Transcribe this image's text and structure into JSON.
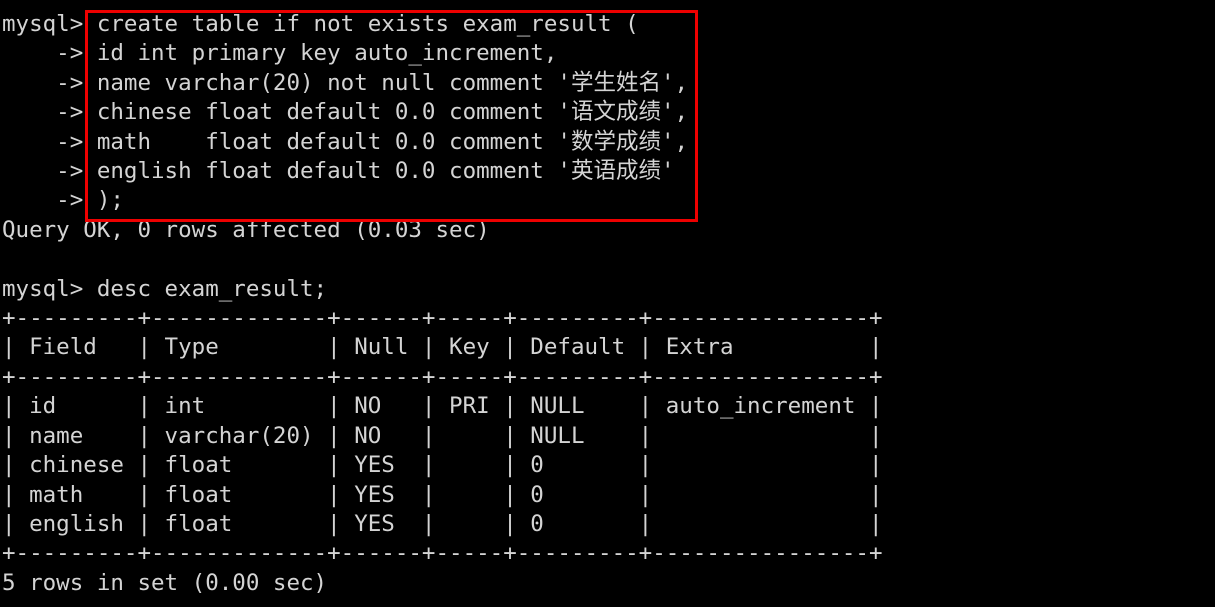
{
  "terminal": {
    "prompt": "mysql>",
    "continuation_prompt": "->",
    "background_color": "#000000",
    "text_color": "#d4d4d4",
    "highlight_box_color": "#ee0000",
    "screen_text": "mysql> create table if not exists exam_result (\n    -> id int primary key auto_increment,\n    -> name varchar(20) not null comment '学生姓名',\n    -> chinese float default 0.0 comment '语文成绩',\n    -> math    float default 0.0 comment '数学成绩',\n    -> english float default 0.0 comment '英语成绩'\n    -> );\nQuery OK, 0 rows affected (0.03 sec)\n\nmysql> desc exam_result;\n+---------+-------------+------+-----+---------+----------------+\n| Field   | Type        | Null | Key | Default | Extra          |\n+---------+-------------+------+-----+---------+----------------+\n| id      | int         | NO   | PRI | NULL    | auto_increment |\n| name    | varchar(20) | NO   |     | NULL    |                |\n| chinese | float       | YES  |     | 0       |                |\n| math    | float       | YES  |     | 0       |                |\n| english | float       | YES  |     | 0       |                |\n+---------+-------------+------+-----+---------+----------------+\n5 rows in set (0.00 sec)",
    "create_statement": {
      "lines": [
        "create table if not exists exam_result (",
        "id int primary key auto_increment,",
        "name varchar(20) not null comment '学生姓名',",
        "chinese float default 0.0 comment '语文成绩',",
        "math    float default 0.0 comment '数学成绩',",
        "english float default 0.0 comment '英语成绩'",
        ");"
      ],
      "result_message": "Query OK, 0 rows affected (0.03 sec)"
    },
    "desc_statement": {
      "command": "desc exam_result;",
      "separator": "+---------+-------------+------+-----+---------+----------------+",
      "columns": [
        "Field",
        "Type",
        "Null",
        "Key",
        "Default",
        "Extra"
      ],
      "rows": [
        [
          "id",
          "int",
          "NO",
          "PRI",
          "NULL",
          "auto_increment"
        ],
        [
          "name",
          "varchar(20)",
          "NO",
          "",
          "NULL",
          ""
        ],
        [
          "chinese",
          "float",
          "YES",
          "",
          "0",
          ""
        ],
        [
          "math",
          "float",
          "YES",
          "",
          "0",
          ""
        ],
        [
          "english",
          "float",
          "YES",
          "",
          "0",
          ""
        ]
      ],
      "result_message": "5 rows in set (0.00 sec)"
    }
  }
}
